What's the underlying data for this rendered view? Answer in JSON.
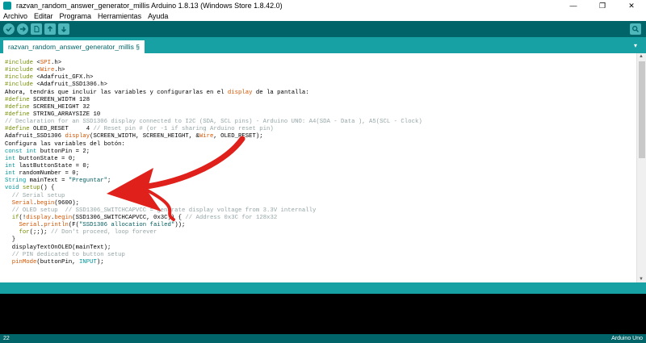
{
  "window": {
    "title": "razvan_random_answer_generator_millis Arduino 1.8.13 (Windows Store 1.8.42.0)",
    "minimize": "—",
    "maximize": "❐",
    "close": "✕"
  },
  "menu": [
    "Archivo",
    "Editar",
    "Programa",
    "Herramientas",
    "Ayuda"
  ],
  "toolbar": {
    "verify_icon": "check-icon",
    "upload_icon": "arrow-right-icon",
    "new_icon": "new-file-icon",
    "open_icon": "open-icon",
    "save_icon": "save-icon",
    "serial_icon": "magnifier-icon"
  },
  "tab": {
    "label": "razvan_random_answer_generator_millis §",
    "dropdown": "▾"
  },
  "code_lines": [
    [
      {
        "c": "kw",
        "t": "#include "
      },
      {
        "c": "pl",
        "t": "<"
      },
      {
        "c": "fn",
        "t": "SPI"
      },
      {
        "c": "pl",
        "t": ".h>"
      }
    ],
    [
      {
        "c": "kw",
        "t": "#include "
      },
      {
        "c": "pl",
        "t": "<"
      },
      {
        "c": "fn",
        "t": "Wire"
      },
      {
        "c": "pl",
        "t": ".h>"
      }
    ],
    [
      {
        "c": "kw",
        "t": "#include "
      },
      {
        "c": "pl",
        "t": "<Adafruit_GFX.h>"
      }
    ],
    [
      {
        "c": "kw",
        "t": "#include "
      },
      {
        "c": "pl",
        "t": "<Adafruit_SSD1306.h>"
      }
    ],
    [
      {
        "c": "pl",
        "t": "Ahora, tendrás que incluir las variables y configurarlas en el "
      },
      {
        "c": "fn",
        "t": "display"
      },
      {
        "c": "pl",
        "t": " de la pantalla:"
      }
    ],
    [
      {
        "c": "kw",
        "t": "#define "
      },
      {
        "c": "pl",
        "t": "SCREEN_WIDTH 128"
      }
    ],
    [
      {
        "c": "kw",
        "t": "#define "
      },
      {
        "c": "pl",
        "t": "SCREEN_HEIGHT 32"
      }
    ],
    [
      {
        "c": "kw",
        "t": "#define "
      },
      {
        "c": "pl",
        "t": "STRING_ARRAYSIZE 10"
      }
    ],
    [
      {
        "c": "cm",
        "t": "// Declaration for an SSD1306 display connected to I2C (SDA, SCL pins) - Arduino UNO: A4(SDA - Data ), A5(SCL - Clock)"
      }
    ],
    [
      {
        "c": "kw",
        "t": "#define "
      },
      {
        "c": "pl",
        "t": "OLED_RESET     4 "
      },
      {
        "c": "cm",
        "t": "// Reset pin # (or -1 if sharing Arduino reset pin)"
      }
    ],
    [
      {
        "c": "pl",
        "t": "Adafruit_SSD1306 "
      },
      {
        "c": "fn",
        "t": "display"
      },
      {
        "c": "pl",
        "t": "(SCREEN_WIDTH, SCREEN_HEIGHT, &"
      },
      {
        "c": "fn",
        "t": "Wire"
      },
      {
        "c": "pl",
        "t": ", OLED_RESET);"
      }
    ],
    [
      {
        "c": "pl",
        "t": "Configura las variables del botón:"
      }
    ],
    [
      {
        "c": "ty",
        "t": "const int "
      },
      {
        "c": "pl",
        "t": "buttonPin = 2;"
      }
    ],
    [
      {
        "c": "ty",
        "t": "int "
      },
      {
        "c": "pl",
        "t": "buttonState = 0;"
      }
    ],
    [
      {
        "c": "ty",
        "t": "int "
      },
      {
        "c": "pl",
        "t": "lastButtonState = 0;"
      }
    ],
    [
      {
        "c": "ty",
        "t": "int "
      },
      {
        "c": "pl",
        "t": "randomNumber = 0;"
      }
    ],
    [
      {
        "c": "ty",
        "t": "String "
      },
      {
        "c": "pl",
        "t": "mainText = "
      },
      {
        "c": "str",
        "t": "\"Preguntar\""
      },
      {
        "c": "pl",
        "t": ";"
      }
    ],
    [
      {
        "c": "ty",
        "t": "void "
      },
      {
        "c": "kw",
        "t": "setup"
      },
      {
        "c": "pl",
        "t": "() {"
      }
    ],
    [
      {
        "c": "cm",
        "t": "  // Serial setup"
      }
    ],
    [
      {
        "c": "pl",
        "t": "  "
      },
      {
        "c": "fn",
        "t": "Serial"
      },
      {
        "c": "pl",
        "t": "."
      },
      {
        "c": "fn",
        "t": "begin"
      },
      {
        "c": "pl",
        "t": "(9600);"
      }
    ],
    [
      {
        "c": "cm",
        "t": "  // OLED setup  // SSD1306_SWITCHCAPVCC = generate display voltage from 3.3V internally"
      }
    ],
    [
      {
        "c": "pl",
        "t": "  "
      },
      {
        "c": "kw",
        "t": "if"
      },
      {
        "c": "pl",
        "t": "(!"
      },
      {
        "c": "fn",
        "t": "display"
      },
      {
        "c": "pl",
        "t": "."
      },
      {
        "c": "fn",
        "t": "begin"
      },
      {
        "c": "pl",
        "t": "(SSD1306_SWITCHCAPVCC, 0x3C)) { "
      },
      {
        "c": "cm",
        "t": "// Address 0x3C for 128x32"
      }
    ],
    [
      {
        "c": "pl",
        "t": "    "
      },
      {
        "c": "fn",
        "t": "Serial"
      },
      {
        "c": "pl",
        "t": "."
      },
      {
        "c": "fn",
        "t": "println"
      },
      {
        "c": "pl",
        "t": "(F("
      },
      {
        "c": "str",
        "t": "\"SSD1306 allocation failed\""
      },
      {
        "c": "pl",
        "t": "));"
      }
    ],
    [
      {
        "c": "pl",
        "t": "    "
      },
      {
        "c": "kw",
        "t": "for"
      },
      {
        "c": "pl",
        "t": "(;;); "
      },
      {
        "c": "cm",
        "t": "// Don't proceed, loop forever"
      }
    ],
    [
      {
        "c": "pl",
        "t": "  }"
      }
    ],
    [
      {
        "c": "pl",
        "t": "  displayTextOnOLED(mainText);"
      }
    ],
    [
      {
        "c": "cm",
        "t": "  // PIN dedicated to button setup"
      }
    ],
    [
      {
        "c": "pl",
        "t": "  "
      },
      {
        "c": "fn",
        "t": "pinMode"
      },
      {
        "c": "pl",
        "t": "(buttonPin, "
      },
      {
        "c": "ty",
        "t": "INPUT"
      },
      {
        "c": "pl",
        "t": ");"
      }
    ]
  ],
  "status": {
    "line_number": "22",
    "board": "Arduino Uno"
  }
}
